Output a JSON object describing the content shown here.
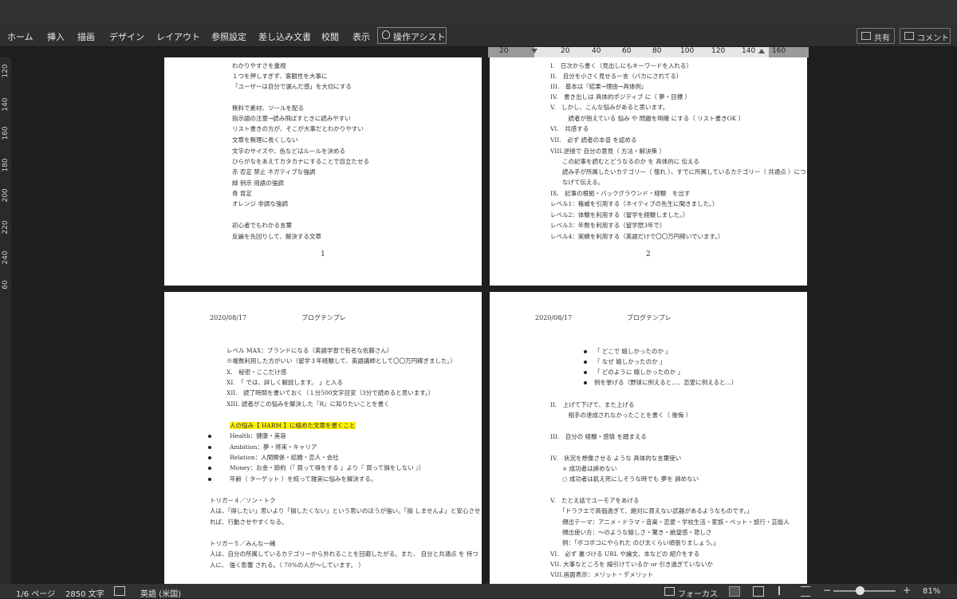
{
  "ribbon": {
    "tabs": [
      "ホーム",
      "挿入",
      "描画",
      "デザイン",
      "レイアウト",
      "参照設定",
      "差し込み文書",
      "校閲",
      "表示"
    ],
    "assist_label": "操作アシスト",
    "share_label": "共有",
    "comment_label": "コメント"
  },
  "ruler": {
    "numbers": [
      "20",
      "",
      "20",
      "40",
      "60",
      "80",
      "100",
      "120",
      "140",
      "160"
    ],
    "vertical": [
      "120",
      "140",
      "160",
      "180",
      "200",
      "220",
      "240",
      "60"
    ]
  },
  "page1": {
    "lines": [
      "わかりやすさを重視",
      "１つを押しすぎず、客観性を大事に",
      "「ユーザーは自分で選んだ感」を大切にする",
      "",
      "無料で素材、ツールを配る",
      "指示語の注意→読み飛ばすときに読みやすい",
      "リスト書きの方が、そこが大事だとわかりやすい",
      "文章を無理に長くしない",
      "文字のサイズや、色などはルールを決める",
      "ひらがなをあえてカタカナにすることで目立たせる",
      "赤 否定 禁止 ネガティブな強調",
      "緑 例示 用語の強調",
      "青 肯定",
      "オレンジ 非調な強調",
      "",
      "初心者でもわかる言葉",
      "反論を先回りして、解決する文章"
    ],
    "page_number": "1"
  },
  "page2": {
    "lines": [
      "I.　日次から書く（見出しにもキーワードを入れる）",
      "II.　自分を小さく見せる一言（バカにされてる）",
      "III.　基本は『結果→理由→具体例』",
      "IV.　書き出しは 具体的ポジティブ に（ 夢・目標 ）",
      "V.　しかし、こんな悩みがあると思います。",
      "　　　読者が抱えている 悩み や 問題を明確 にする（ リスト書きOK ）",
      "VI.　共感する",
      "VII.　必ず 読者の本音 を認める",
      "VIII.逆接で 自分の意見（ 方法・解決策 ）",
      "　　この記事を読むとどうなるのか を 具体的に 伝える",
      "　　読み手が所属したいカテゴリー（ 憧れ ）、すでに所属しているカテゴリー（ 共通点 ）につ",
      "　　なげて伝える。",
      "IX.　記事の根拠・バックグラウンド・経験　を出す",
      "レベル1：権威を引用する（ネイティブの先生に聞きました。）",
      "レベル2：体験を利用する（留学を経験しました。）",
      "レベル3：年数を利用する（留学歴3年で）",
      "レベル4：実績を利用する（英語だけで〇〇万円稼いでいます。）"
    ],
    "page_number": "2"
  },
  "page3": {
    "header_date": "2020/08/17",
    "header_title": "ブログテンプレ",
    "lines": [
      "レベル MAX：ブランドになる（英語学習で有名な佐藤さん）",
      "※複数利用した方がいい（留学３年経験して、英語講師として〇〇万円稼ぎました。）",
      "X.　秘密・ここだけ感",
      "XI.　「 では、詳しく解説します。 」と入る",
      "XII.　読了時間を書いておく（１分500文字目安（3分で読めると思います。）",
      "XIII. 読者がこの悩みを解決した『R』に知りたいことを書く"
    ],
    "highlight": "人の悩み【 HARM 】に絡めた文章を書くこと",
    "bullets": [
      "Health：健康・美容",
      "Ambition：夢・将来・キャリア",
      "Relation：人間関係・結婚・恋人・会社",
      "Money：お金・節約（『 買って得をする 』より『 買って損をしない 』）",
      "年齢（ ターゲット ）を絞って雑実に悩みを解決する。"
    ],
    "trigger4_title": "トリガー４／ソン・トク",
    "trigger4_text1": "人は、「得したい」思いより「損したくない」という思いのほうが強い。「損 しませんよ」と安心させ",
    "trigger4_text2": "れば、行動させやすくなる。",
    "trigger5_title": "トリガー５／みんな一緒",
    "trigger5_text1": "人は、自分の所属しているカテゴリーから外れることを回避したがる。また、 自分と共通点 を 持つ",
    "trigger5_text2": "人に、 強く影響 される。（ 70%の人が〜しています。 ）"
  },
  "page4": {
    "header_date": "2020/08/17",
    "header_title": "ブログテンプレ",
    "bullets": [
      "「 どこで 嬉しかったのか 」",
      "「 なぜ 嬉しかったのか 」",
      "「 どのように 嬉しかったのか 」",
      "例を挙げる（野球に例えると…、恋愛に例えると…）"
    ],
    "lines": [
      "II.　上げて下げて、また上げる",
      "　　　相手の達成されなかったことを書く（ 後悔 ）",
      "III.　自分の 経験・感情 を踏まえる",
      "IV.　状況を想像させる ような 具体的な言葉使い",
      "　　× 成功者は諦めない",
      "　　○ 成功者は飢え死にしそうな時でも 夢を 諦めない",
      "V.　たとえ話でユーモアをあげる",
      "　　「ドラクエで高価過ぎて、絶対に買えない武器があるようなものです。」",
      "　　頻出テーマ：アニメ・ドラマ・音楽・恋愛・学校生活・家族・ペット・旅行・芸能人",
      "　　頻出使い方：〜のような嬉しさ・驚き・絶望感・悲しさ",
      "　　例：「ボコボコにやられた のび太くらい頑張りましょう。」",
      "VI.　必ず 裏づける URL や論文、本などの 紹介をする",
      "VII. 大事なところを 線引けているか or 引き過ぎていないか",
      "VIII.画面表示：メリット・デメリット"
    ]
  },
  "status": {
    "page": "1/6 ページ",
    "words": "2850 文字",
    "language": "英語 (米国)",
    "focus": "フォーカス",
    "zoom": "81%"
  }
}
